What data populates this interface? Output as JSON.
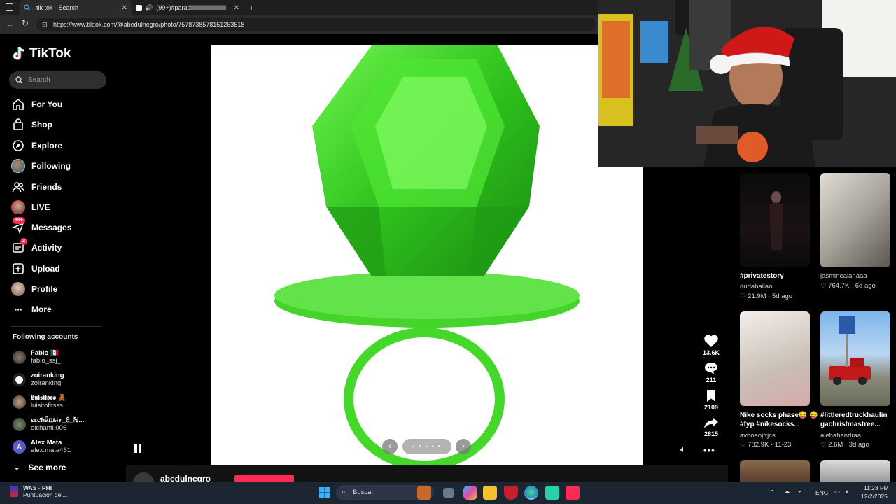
{
  "browser": {
    "tabs": [
      {
        "label": "tik tok - Search",
        "active": true
      },
      {
        "label": "(99+)#paratiiiiiiiiiiiiiiiiiiiiiiiiiii",
        "active": false
      }
    ],
    "url": "https://www.tiktok.com/@abedulnegro/photo/7578738578151263518"
  },
  "sidebar": {
    "logo": "TikTok",
    "search_placeholder": "Search",
    "nav": [
      {
        "label": "For You",
        "icon": "home-icon"
      },
      {
        "label": "Shop",
        "icon": "shop-bag-icon"
      },
      {
        "label": "Explore",
        "icon": "compass-icon"
      },
      {
        "label": "Following",
        "icon": "following-avatar-icon"
      },
      {
        "label": "Friends",
        "icon": "friends-icon"
      },
      {
        "label": "LIVE",
        "icon": "live-avatar-icon"
      },
      {
        "label": "Messages",
        "icon": "messages-icon",
        "badge": "99+"
      },
      {
        "label": "Activity",
        "icon": "activity-icon",
        "badge": "2"
      },
      {
        "label": "Upload",
        "icon": "upload-icon"
      },
      {
        "label": "Profile",
        "icon": "profile-avatar-icon"
      },
      {
        "label": "More",
        "icon": "more-dots-icon"
      }
    ],
    "following_title": "Following accounts",
    "following": [
      {
        "name": "Fabio 🇲🇽",
        "handle": "fabio_ssj_"
      },
      {
        "name": "zoiranking",
        "handle": "zoiranking"
      },
      {
        "name": "𝕷𝖚𝖎𝖘𝖎𝖙𝖔𝖔𝖔 🧸",
        "handle": "luisitofitsss"
      },
      {
        "name": "ɛʟƈɦǟռȶɨʏ_ℰ_ℕ...",
        "handle": "elchanti.006"
      },
      {
        "name": "Alex Mata",
        "handle": "alex.mata461"
      }
    ],
    "see_more": "See more"
  },
  "post": {
    "author_partial": "abedulnegro",
    "carousel_dots": "• • • • •"
  },
  "actions": {
    "likes": "13.6K",
    "comments": "211",
    "saves": "2109",
    "shares": "2815"
  },
  "recommendations": [
    {
      "title": "#privatestory",
      "user": "dudabailao",
      "views": "21.9M",
      "age": "5d ago"
    },
    {
      "title": "",
      "user": "jasminealanaaa",
      "views": "764.7K",
      "age": "6d ago"
    },
    {
      "title": "Nike socks phase😝 😝#fyp #nikesocks...",
      "user": "avhoeojfrjcs",
      "views": "782.9K",
      "age": "11-23"
    },
    {
      "title": "#littleredtruckhaulin gachristmastree...",
      "user": "alehahandraa",
      "views": "2.6M",
      "age": "3d ago"
    }
  ],
  "taskbar": {
    "stream_title": "WAS - PHI",
    "stream_sub": "Puntuación del...",
    "search_label": "Buscar",
    "lang": "ENG",
    "time": "11:23 PM",
    "date": "12/2/2025"
  },
  "colors": {
    "accent": "#fe2c55",
    "gem_green": "#3fdc2a",
    "taskbar": "#1c2532"
  }
}
